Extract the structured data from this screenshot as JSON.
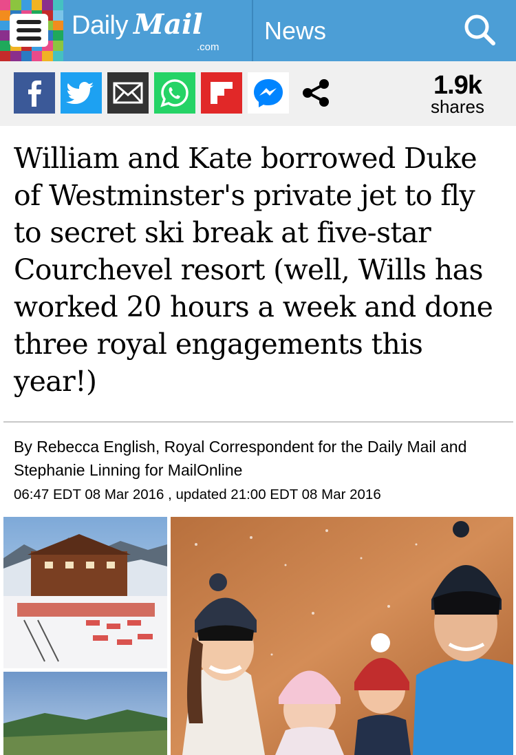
{
  "header": {
    "logo_daily": "Daily",
    "logo_mail": "Mail",
    "logo_com": ".com",
    "section": "News",
    "menu_icon": "hamburger-menu-icon",
    "search_icon": "search-icon",
    "background_color": "#4c9ed6"
  },
  "share": {
    "buttons": [
      {
        "name": "facebook",
        "icon": "facebook-icon",
        "color": "#3b5998"
      },
      {
        "name": "twitter",
        "icon": "twitter-icon",
        "color": "#1da1f2"
      },
      {
        "name": "email",
        "icon": "email-icon",
        "color": "#333333"
      },
      {
        "name": "whatsapp",
        "icon": "whatsapp-icon",
        "color": "#25d366"
      },
      {
        "name": "flipboard",
        "icon": "flipboard-icon",
        "color": "#e12828"
      },
      {
        "name": "messenger",
        "icon": "messenger-icon",
        "color": "#0084ff"
      },
      {
        "name": "share",
        "icon": "share-icon",
        "color": "#000000"
      }
    ],
    "count": "1.9k",
    "count_label": "shares"
  },
  "article": {
    "headline": "William and Kate borrowed Duke of Westminster's private jet to fly to secret ski break at five-star Courchevel resort (well, Wills has worked 20 hours a week and done three royal engagements this year!)",
    "byline": "By Rebecca English, Royal Correspondent for the Daily Mail and Stephanie Linning for MailOnline",
    "dateline": "06:47 EDT 08 Mar 2016 , updated 21:00 EDT 08 Mar 2016"
  }
}
